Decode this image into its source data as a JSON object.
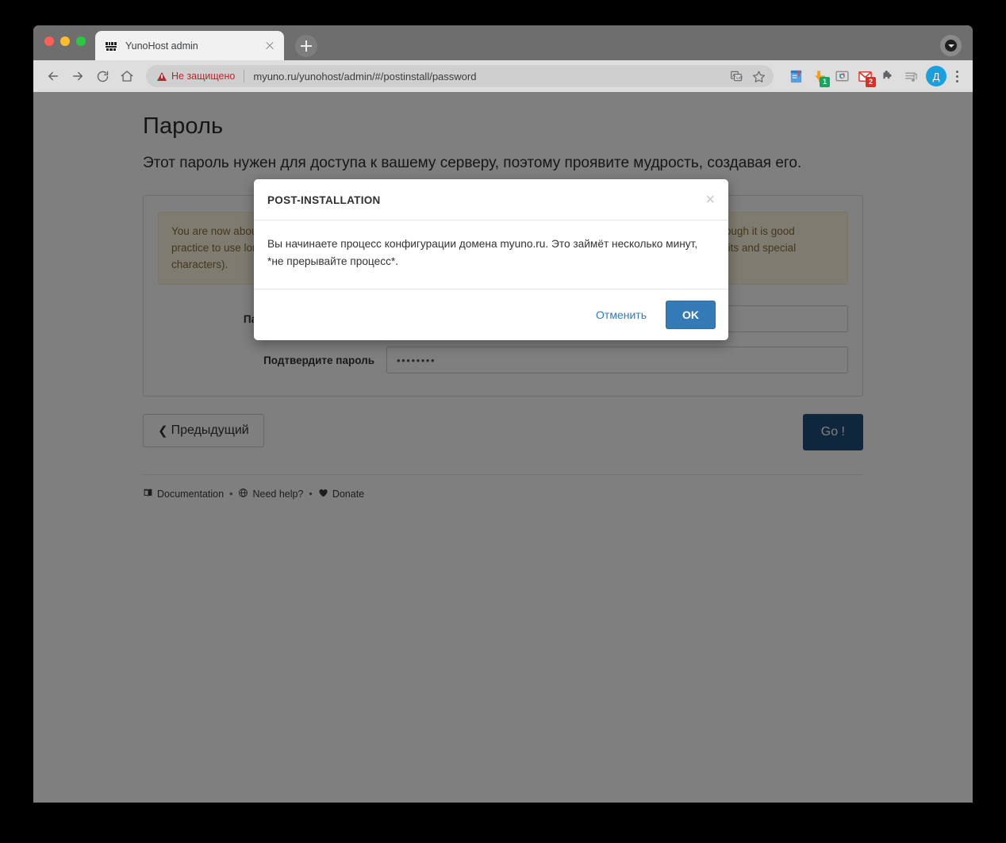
{
  "browser": {
    "tab": {
      "title": "YunoHost admin",
      "favicon_name": "yunohost-logo-favicon",
      "close_label": "×"
    },
    "new_tab_label": "+",
    "toolbar": {
      "back_label": "Back",
      "forward_label": "Forward",
      "reload_label": "Reload",
      "home_label": "Home",
      "security_status": "Не защищено",
      "security_status_color": "#b8272d",
      "url": "myuno.ru/yunohost/admin/#/postinstall/password",
      "translate_label": "Translate",
      "bookmark_label": "Bookmark",
      "profile_initial": "Д",
      "profile_color": "#1a9fe0",
      "extensions": [
        {
          "name": "dictionary-extension-icon",
          "badge": ""
        },
        {
          "name": "download-manager-extension-icon",
          "badge": "1",
          "badge_color": "#1aa260"
        },
        {
          "name": "chrome-remote-desktop-extension-icon",
          "badge": ""
        },
        {
          "name": "gmail-extension-icon",
          "badge": "2",
          "badge_color": "#d93025"
        },
        {
          "name": "puzzle-extensions-icon",
          "badge": ""
        },
        {
          "name": "playlist-extension-icon",
          "badge": ""
        }
      ]
    }
  },
  "page": {
    "title": "Пароль",
    "description": "Этот пароль нужен для доступа к вашему серверу, поэтому проявите мудрость, создавая его.",
    "warning_alert": "You are now about to define a new administration password. The password should be at least 8 characters long — though it is good practice to use longer password (i.e. a passphrase) and/or to use a variation of characters (uppercase, lowercase, digits and special characters).",
    "form": {
      "admin_password_label": "Пароль администратора",
      "admin_password_value": "••••••••",
      "confirm_password_label": "Подтвердите пароль",
      "confirm_password_value": "••••••••"
    },
    "nav": {
      "previous_label": "Предыдущий",
      "go_label": "Go !",
      "go_color": "#1f4e79"
    },
    "footer": {
      "documentation_label": "Documentation",
      "need_help_label": "Need help?",
      "donate_label": "Donate",
      "separator": "•"
    }
  },
  "modal": {
    "title": "POST-INSTALLATION",
    "close_label": "×",
    "body": "Вы начинаете процесс конфигурации домена myuno.ru. Это займёт несколько минут, *не прерывайте процесс*.",
    "cancel_label": "Отменить",
    "ok_label": "OK",
    "ok_color": "#337ab7"
  }
}
